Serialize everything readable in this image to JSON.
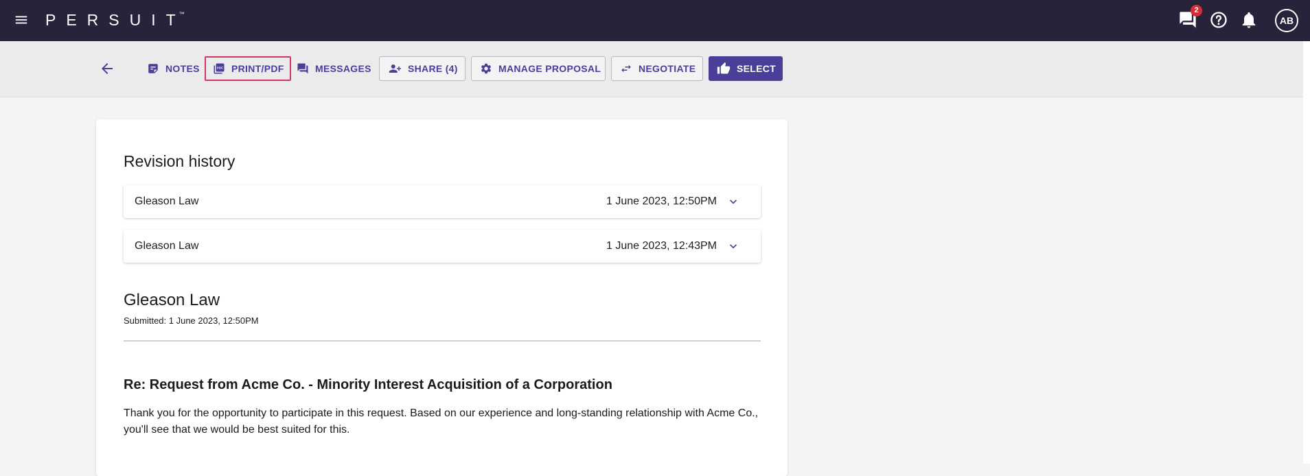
{
  "app": {
    "logo_text": "PERSUIT",
    "logo_tm": "™",
    "topbar_color": "#28233b",
    "messages_badge": "2",
    "avatar_initials": "AB"
  },
  "toolbar": {
    "notes": "NOTES",
    "print_pdf": "PRINT/PDF",
    "messages": "MESSAGES",
    "share": "SHARE (4)",
    "manage_proposal": "MANAGE PROPOSAL",
    "negotiate": "NEGOTIATE",
    "select": "SELECT",
    "accent_color": "#4a3f98",
    "highlight_color": "#d6336c"
  },
  "revision_history": {
    "title": "Revision history",
    "rows": [
      {
        "name": "Gleason Law",
        "date": "1 June 2023, 12:50PM"
      },
      {
        "name": "Gleason Law",
        "date": "1 June 2023, 12:43PM"
      }
    ]
  },
  "proposal": {
    "firm": "Gleason Law",
    "submitted": "Submitted: 1 June 2023, 12:50PM",
    "subject": "Re: Request from Acme Co. - Minority Interest Acquisition of a Corporation",
    "body": "Thank you for the opportunity to participate in this request. Based on our experience and long-standing relationship with Acme Co., you'll see that we would be best suited for this."
  },
  "icons": [
    "menu-icon",
    "chat-icon",
    "help-icon",
    "bell-icon",
    "back-arrow-icon",
    "notes-icon",
    "pdf-icon",
    "messages-icon",
    "add-user-icon",
    "gear-icon",
    "swap-icon",
    "thumbs-up-icon",
    "chevron-down-icon"
  ]
}
